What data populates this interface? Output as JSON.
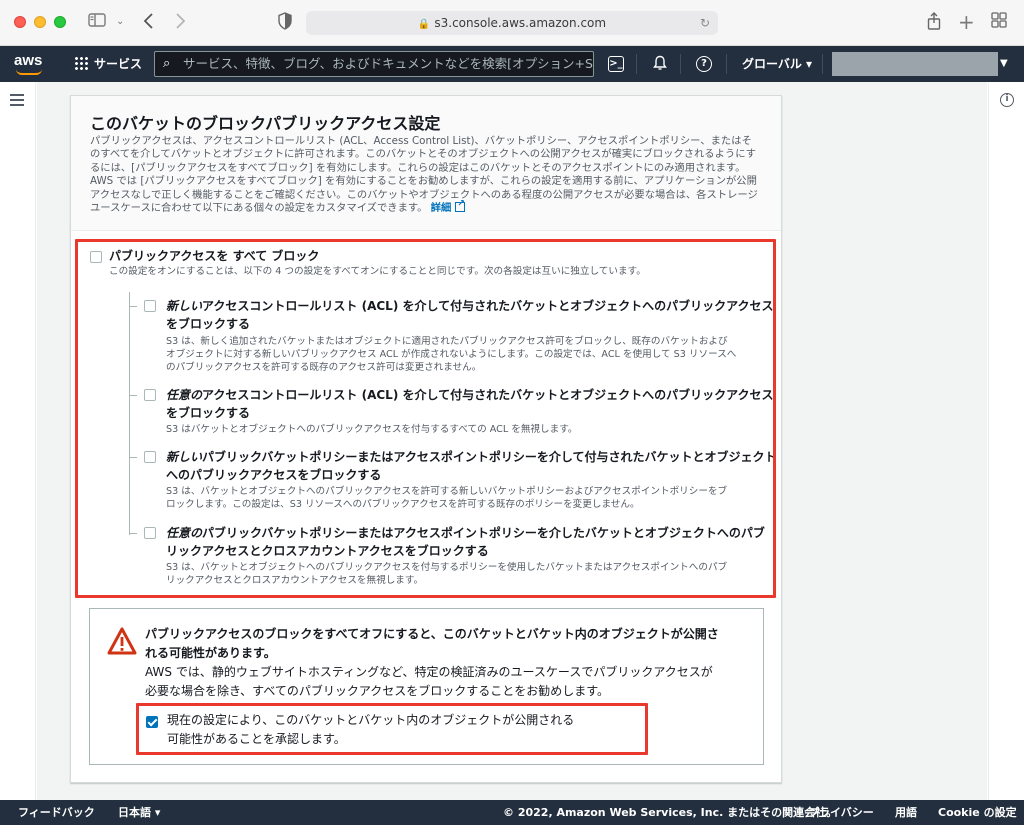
{
  "browser": {
    "url": "s3.console.aws.amazon.com",
    "icons": [
      "sidebar-icon",
      "back-icon",
      "forward-icon",
      "shield-icon",
      "lock-icon",
      "reload-icon",
      "share-icon",
      "new-tab-icon",
      "tab-overview-icon"
    ]
  },
  "awsnav": {
    "services_label": "サービス",
    "search_placeholder": "サービス、特徴、ブログ、およびドキュメントなどを検索",
    "search_shortcut": "[オプション+S]",
    "region_label": "グローバル ▾",
    "account_caret": "▼"
  },
  "panel": {
    "title": "このバケットのブロックパブリックアクセス設定",
    "description": "パブリックアクセスは、アクセスコントロールリスト (ACL、Access Control List)、バケットポリシー、アクセスポイントポリシー、またはそのすべてを介してバケットとオブジェクトに許可されます。このバケットとそのオブジェクトへの公開アクセスが確実にブロックされるようにするには、[パブリックアクセスをすべてブロック] を有効にします。これらの設定はこのバケットとそのアクセスポイントにのみ適用されます。AWS では [パブリックアクセスをすべてブロック] を有効にすることをお勧めしますが、これらの設定を適用する前に、アプリケーションが公開アクセスなしで正しく機能することをご確認ください。このバケットやオブジェクトへのある程度の公開アクセスが必要な場合は、各ストレージユースケースに合わせて以下にある個々の設定をカスタマイズできます。",
    "link_label": "詳細"
  },
  "block_all": {
    "title": "パブリックアクセスを すべて ブロック",
    "desc": "この設定をオンにすることは、以下の 4 つの設定をすべてオンにすることと同じです。次の各設定は互いに独立しています。",
    "checked": false
  },
  "options": [
    {
      "title_em": "新しい",
      "title_rest_1": "アクセスコントロールリスト (ACL) を介して付与されたバケットとオブジェクトへのパブリックアクセス",
      "title_rest_2": "をブロックする",
      "desc_1": "S3 は、新しく追加されたバケットまたはオブジェクトに適用されたパブリックアクセス許可をブロックし、既存のバケットおよび",
      "desc_2": "オブジェクトに対する新しいパブリックアクセス ACL が作成されないようにします。この設定では、ACL を使用して S3 リソースへ",
      "desc_3": "のパブリックアクセスを許可する既存のアクセス許可は変更されません。",
      "checked": false
    },
    {
      "title_em": "任意の",
      "title_rest_1": "アクセスコントロールリスト (ACL) を介して付与されたバケットとオブジェクトへのパブリックアクセス",
      "title_rest_2": "をブロックする",
      "desc_1": "S3 はバケットとオブジェクトへのパブリックアクセスを付与するすべての ACL を無視します。",
      "checked": false
    },
    {
      "title_em": "新しい",
      "title_rest_1": "パブリックバケットポリシーまたはアクセスポイントポリシーを介して付与されたバケットとオブジェクト",
      "title_rest_2": "へのパブリックアクセスをブロックする",
      "desc_1": "S3 は、バケットとオブジェクトへのパブリックアクセスを許可する新しいバケットポリシーおよびアクセスポイントポリシーをブ",
      "desc_2": "ロックします。この設定は、S3 リソースへのパブリックアクセスを許可する既存のポリシーを変更しません。",
      "checked": false
    },
    {
      "title_em": "任意の",
      "title_rest_1": "パブリックバケットポリシーまたはアクセスポイントポリシーを介したバケットとオブジェクトへのパブ",
      "title_rest_2": "リックアクセスとクロスアカウントアクセスをブロックする",
      "desc_1": "S3 は、バケットとオブジェクトへのパブリックアクセスを付与するポリシーを使用したバケットまたはアクセスポイントへのパブ",
      "desc_2": "リックアクセスとクロスアカウントアクセスを無視します。",
      "checked": false
    }
  ],
  "warning": {
    "title_1": "パブリックアクセスのブロックをすべてオフにすると、このバケットとバケット内のオブジェクトが公開さ",
    "title_2": "れる可能性があります。",
    "body_1": "AWS では、静的ウェブサイトホスティングなど、特定の検証済みのユースケースでパブリックアクセスが",
    "body_2": "必要な場合を除き、すべてのパブリックアクセスをブロックすることをお勧めします。",
    "ack_1": "現在の設定により、このバケットとバケット内のオブジェクトが公開される",
    "ack_2": "可能性があることを承認します。",
    "ack_checked": true
  },
  "footer": {
    "feedback": "フィードバック",
    "language": "日本語 ▾",
    "copyright": "© 2022, Amazon Web Services, Inc. またはその関連会社。",
    "privacy": "プライバシー",
    "terms": "用語",
    "cookie": "Cookie の設定"
  },
  "colors": {
    "highlight_red": "#e8392c",
    "aws_nav": "#232f3e",
    "link_blue": "#0073bb",
    "warning_red": "#d13212"
  }
}
